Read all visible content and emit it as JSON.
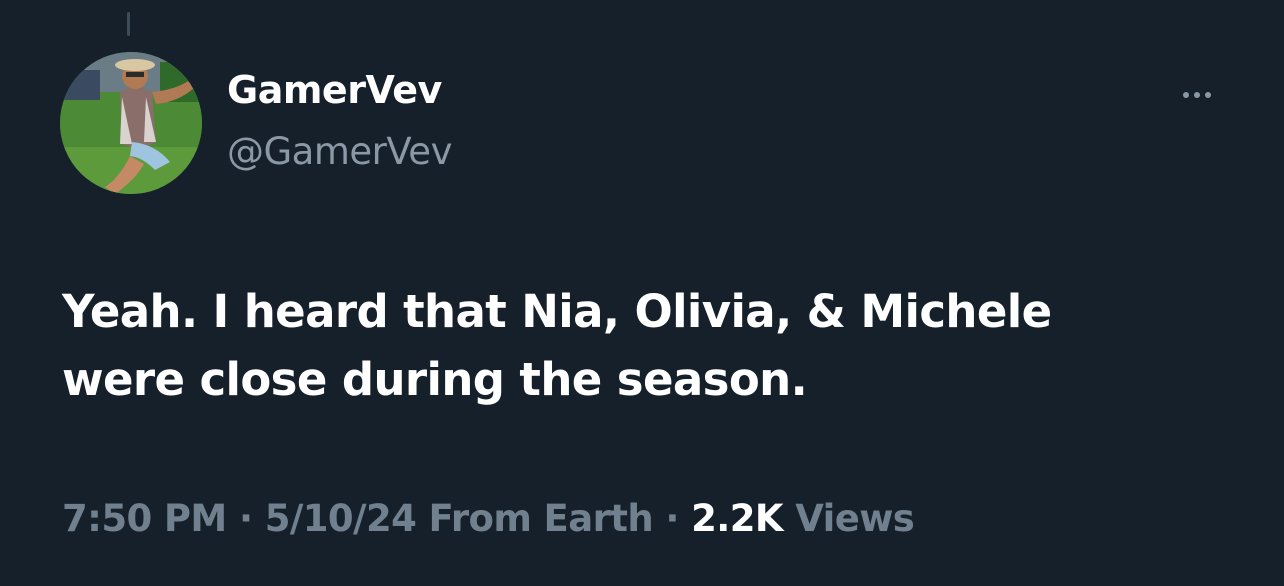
{
  "author": {
    "display_name": "GamerVev",
    "handle": "@GamerVev"
  },
  "tweet": {
    "lines": [
      "Yeah. I heard that Nia, Olivia, & Michele",
      "were close during the season."
    ]
  },
  "meta": {
    "time": "7:50 PM",
    "separator": " · ",
    "date": "5/10/24",
    "source": "From Earth",
    "views_count": "2.2K",
    "views_label": "Views"
  },
  "icons": {
    "more": "more-horizontal-icon"
  },
  "colors": {
    "background": "#15202b",
    "primary_text": "#ffffff",
    "secondary_text": "#8b98a5"
  }
}
